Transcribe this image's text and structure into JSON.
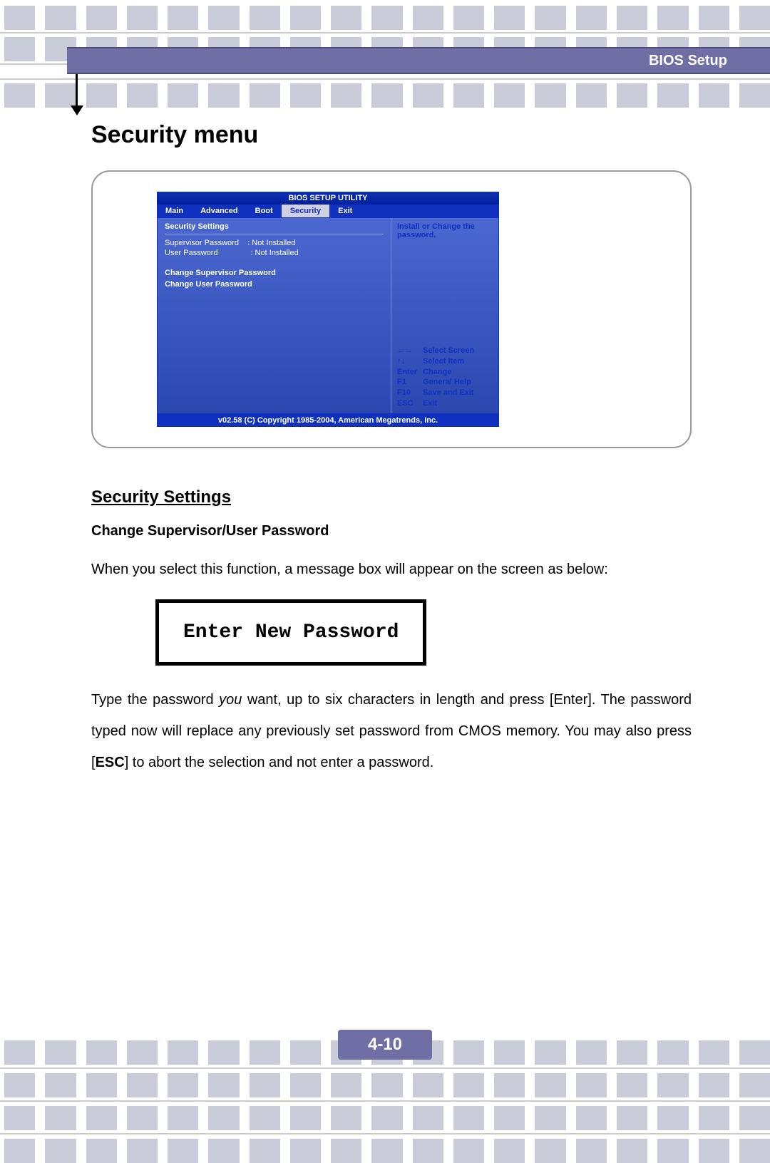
{
  "header": {
    "title": "BIOS Setup"
  },
  "section_title": "Security menu",
  "bios": {
    "utility_title": "BIOS SETUP UTILITY",
    "tabs": {
      "main": "Main",
      "advanced": "Advanced",
      "boot": "Boot",
      "security": "Security",
      "exit": "Exit"
    },
    "left": {
      "heading": "Security Settings",
      "sup_label": "Supervisor Password",
      "sup_value": ": Not Installed",
      "usr_label": "User Password",
      "usr_value": ": Not Installed",
      "change_sup": "Change Supervisor Password",
      "change_usr": "Change User Password"
    },
    "right": {
      "help_line1": "Install or Change the",
      "help_line2": "password.",
      "keys": {
        "lr": "←→",
        "lr_d": "Select Screen",
        "ud": "↑↓",
        "ud_d": "Select Item",
        "enter": "Enter",
        "enter_d": "Change",
        "f1": "F1",
        "f1_d": "General Help",
        "f10": "F10",
        "f10_d": "Save and Exit",
        "esc": "ESC",
        "esc_d": "Exit"
      }
    },
    "footer": "v02.58 (C) Copyright 1985-2004, American Megatrends, Inc."
  },
  "body": {
    "subsection": "Security Settings",
    "subsub": "Change Supervisor/User Password",
    "para1": "When you select this function, a message box will appear on the screen as below:",
    "pw_box": "Enter New Password",
    "para2a": "Type the password ",
    "para2_em": "you",
    "para2b": " want, up to six characters in length and press [Enter].   The password typed now will replace any previously set password from CMOS memory. You may also press [",
    "para2_esc": "ESC",
    "para2c": "] to abort the selection and not enter a password."
  },
  "page_number": "4-10"
}
